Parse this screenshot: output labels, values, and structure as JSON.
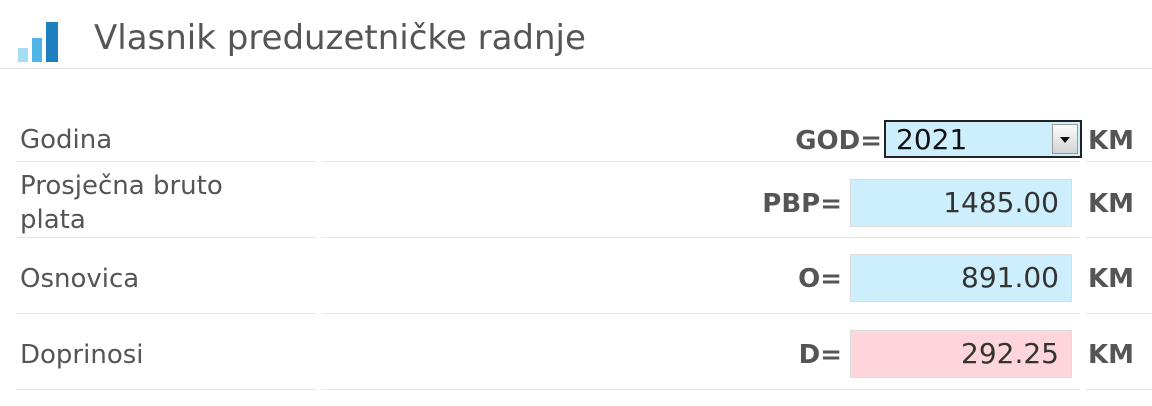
{
  "header": {
    "title": "Vlasnik preduzetničke radnje",
    "icon": "bar-chart-icon",
    "icon_colors": [
      "#a6dcf4",
      "#4fb5e6",
      "#1d7ec0"
    ]
  },
  "rows": [
    {
      "label": "Godina",
      "symbol": "GOD=",
      "value": "2021",
      "unit": "KM",
      "control": "select"
    },
    {
      "label": "Prosječna bruto plata",
      "symbol": "PBP=",
      "value": "1485.00",
      "unit": "KM",
      "color": "#cdeefd"
    },
    {
      "label": "Osnovica",
      "symbol": "O=",
      "value": "891.00",
      "unit": "KM",
      "color": "#cdeefd"
    },
    {
      "label": "Doprinosi",
      "symbol": "D=",
      "value": "292.25",
      "unit": "KM",
      "color": "#fdd5da"
    }
  ]
}
